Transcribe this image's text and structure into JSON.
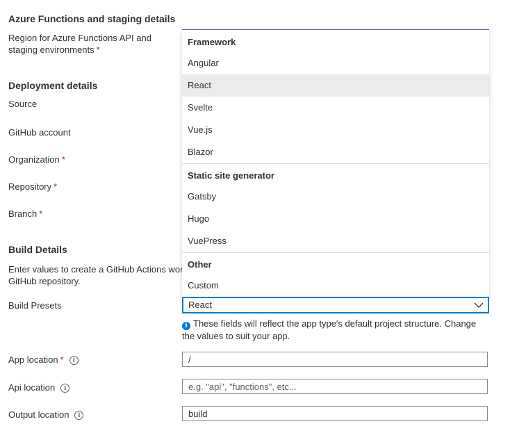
{
  "sections": {
    "azure": "Azure Functions and staging details",
    "deployment": "Deployment details",
    "build": "Build Details"
  },
  "labels": {
    "region": "Region for Azure Functions API and staging environments",
    "source": "Source",
    "github_account": "GitHub account",
    "organization": "Organization",
    "repository": "Repository",
    "branch": "Branch",
    "build_desc": "Enter values to create a GitHub Actions wor",
    "build_desc2": "GitHub repository.",
    "build_presets": "Build Presets",
    "app_location": "App location",
    "api_location": "Api location",
    "output_location": "Output location"
  },
  "required_mark": "*",
  "dropdown": {
    "groups": [
      {
        "header": "Framework",
        "items": [
          "Angular",
          "React",
          "Svelte",
          "Vue.js",
          "Blazor"
        ]
      },
      {
        "header": "Static site generator",
        "items": [
          "Gatsby",
          "Hugo",
          "VuePress"
        ]
      },
      {
        "header": "Other",
        "items": [
          "Custom"
        ]
      }
    ],
    "selected": "React"
  },
  "build_presets_value": "React",
  "note": "These fields will reflect the app type's default project structure. Change the values to suit your app.",
  "inputs": {
    "app_location": {
      "value": "/",
      "placeholder": ""
    },
    "api_location": {
      "value": "",
      "placeholder": "e.g. \"api\", \"functions\", etc..."
    },
    "output_location": {
      "value": "build",
      "placeholder": ""
    }
  },
  "colors": {
    "required": "#a4262c",
    "focus": "#0078d4",
    "selected_bg": "#edebe9"
  }
}
